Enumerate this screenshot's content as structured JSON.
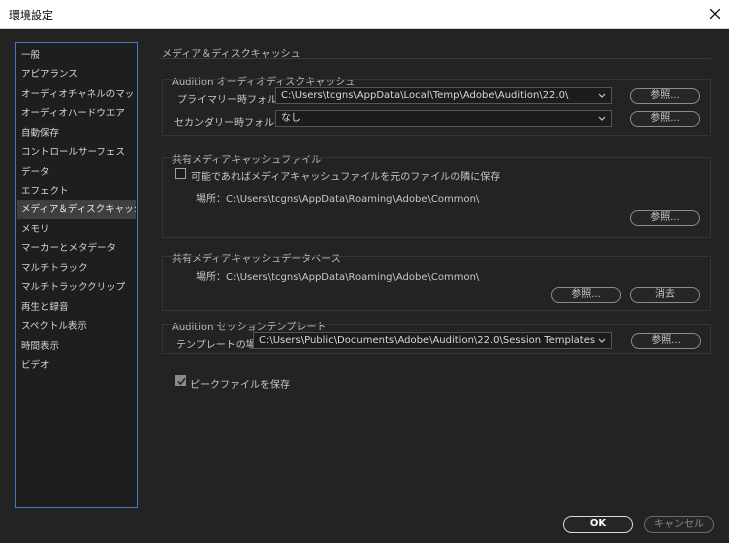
{
  "window": {
    "title": "環境設定"
  },
  "sidebar": {
    "items": [
      {
        "label": "一般"
      },
      {
        "label": "アピアランス"
      },
      {
        "label": "オーディオチャネルのマッピング"
      },
      {
        "label": "オーディオハードウエア"
      },
      {
        "label": "自動保存"
      },
      {
        "label": "コントロールサーフェス"
      },
      {
        "label": "データ"
      },
      {
        "label": "エフェクト"
      },
      {
        "label": "メディア＆ディスクキャッシュ",
        "selected": true
      },
      {
        "label": "メモリ"
      },
      {
        "label": "マーカーとメタデータ"
      },
      {
        "label": "マルチトラック"
      },
      {
        "label": "マルチトラッククリップ"
      },
      {
        "label": "再生と録音"
      },
      {
        "label": "スペクトル表示"
      },
      {
        "label": "時間表示"
      },
      {
        "label": "ビデオ"
      }
    ]
  },
  "main": {
    "section_title": "メディア＆ディスクキャッシュ",
    "audio_cache": {
      "title": "Audition オーディオディスクキャッシュ",
      "primary_label": "プライマリー時フォルダー：",
      "primary_value": "C:\\Users\\tcgns\\AppData\\Local\\Temp\\Adobe\\Audition\\22.0\\",
      "secondary_label": "セカンダリー時フォルダー：",
      "secondary_value": "なし",
      "browse_label": "参照..."
    },
    "shared_media_file": {
      "title": "共有メディアキャッシュファイル",
      "checkbox_label": "可能であればメディアキャッシュファイルを元のファイルの隣に保存",
      "checkbox_checked": false,
      "location": "場所：C:\\Users\\tcgns\\AppData\\Roaming\\Adobe\\Common\\",
      "browse_label": "参照..."
    },
    "shared_media_db": {
      "title": "共有メディアキャッシュデータベース",
      "location": "場所：C:\\Users\\tcgns\\AppData\\Roaming\\Adobe\\Common\\",
      "browse_label": "参照...",
      "clear_label": "消去"
    },
    "session_template": {
      "title": "Audition セッションテンプレート",
      "location_label": "テンプレートの場所：",
      "location_value": "C:\\Users\\Public\\Documents\\Adobe\\Audition\\22.0\\Session Templates",
      "browse_label": "参照..."
    },
    "peak_files": {
      "label": "ピークファイルを保存",
      "checked": true
    }
  },
  "footer": {
    "ok_label": "OK",
    "cancel_label": "キャンセル"
  }
}
